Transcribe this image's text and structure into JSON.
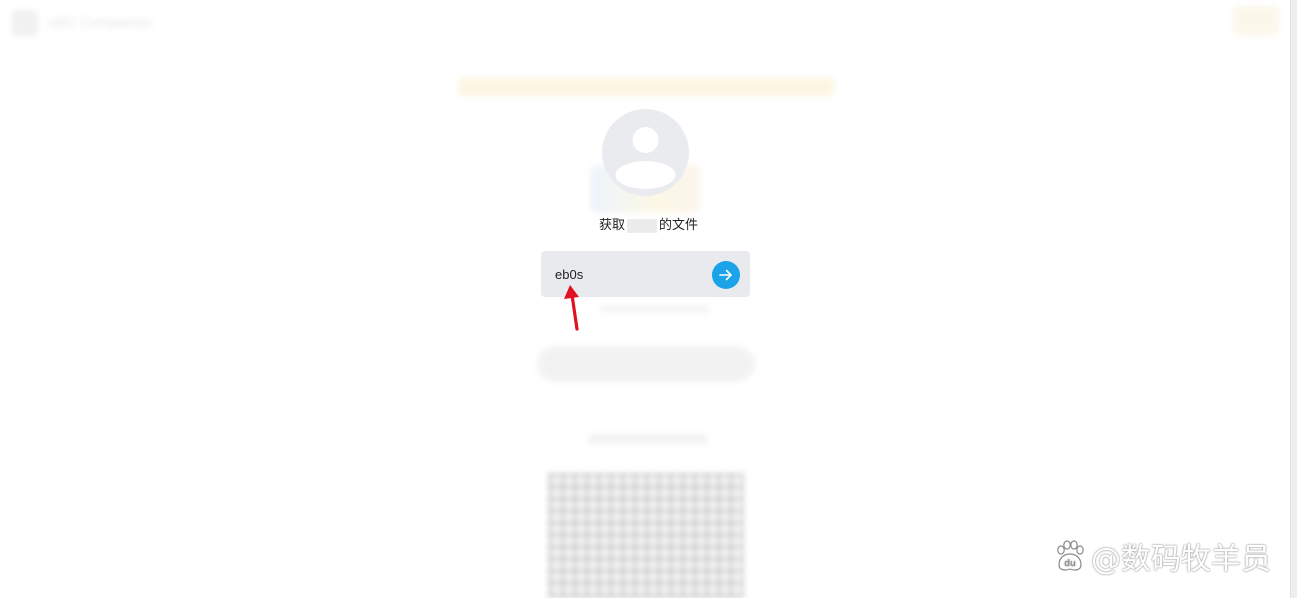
{
  "header": {
    "title": "ABC Companion"
  },
  "share": {
    "caption_prefix": "获取",
    "caption_suffix": "的文件"
  },
  "code_field": {
    "value": "eb0s"
  },
  "watermark": {
    "text": "@数码牧羊员",
    "logo_text": "du"
  },
  "colors": {
    "accent": "#1aa3e8",
    "annotation": "#e0121f",
    "field_bg": "#e8eaed",
    "avatar_bg": "#e9ebee"
  },
  "icons": {
    "avatar": "user-silhouette-icon",
    "submit": "arrow-right-icon",
    "annotation": "red-arrow-icon",
    "watermark": "paw-icon"
  }
}
